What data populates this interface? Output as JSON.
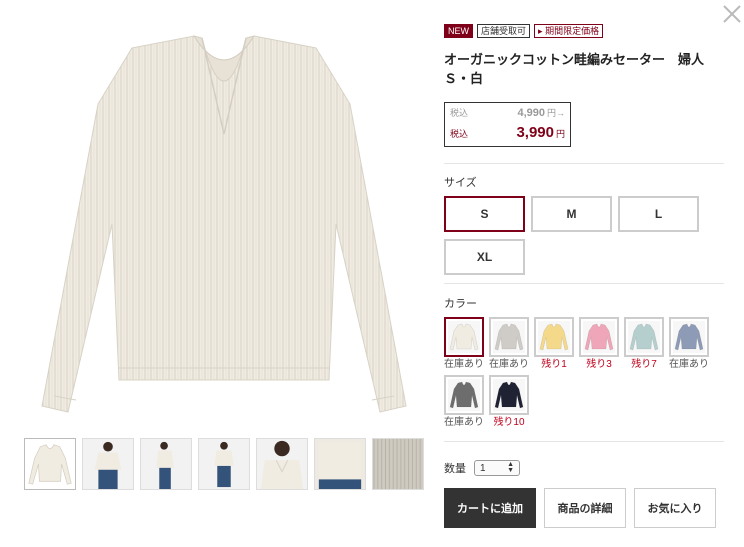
{
  "product": {
    "badges": {
      "new": "NEW",
      "store": "店舗受取可",
      "limited": "期間限定価格",
      "limited_marker": "▸"
    },
    "title_line1": "オーガニックコットン畦編みセーター　婦人",
    "title_line2": "Ｓ・白"
  },
  "price": {
    "original_tax_label": "税込",
    "original_amount": "4,990",
    "original_unit": "円→",
    "sale_tax_label": "税込",
    "sale_amount": "3,990",
    "sale_unit": "円"
  },
  "size": {
    "label": "サイズ",
    "options": [
      "S",
      "M",
      "L",
      "XL"
    ],
    "selected": "S"
  },
  "color": {
    "label": "カラー",
    "options": [
      {
        "hex": "#f1ece2",
        "stock": "在庫あり",
        "low": false,
        "selected": true
      },
      {
        "hex": "#cfcbc6",
        "stock": "在庫あり",
        "low": false,
        "selected": false
      },
      {
        "hex": "#f4d98a",
        "stock": "残り1",
        "low": true,
        "selected": false
      },
      {
        "hex": "#eea6b8",
        "stock": "残り3",
        "low": true,
        "selected": false
      },
      {
        "hex": "#b5cfcf",
        "stock": "残り7",
        "low": true,
        "selected": false
      },
      {
        "hex": "#8e9bb6",
        "stock": "在庫あり",
        "low": false,
        "selected": false
      },
      {
        "hex": "#6d6d6d",
        "stock": "在庫あり",
        "low": false,
        "selected": false
      },
      {
        "hex": "#1f2233",
        "stock": "残り10",
        "low": true,
        "selected": false
      }
    ]
  },
  "quantity": {
    "label": "数量",
    "value": "1"
  },
  "buttons": {
    "cart": "カートに追加",
    "detail": "商品の詳細",
    "favorite": "お気に入り"
  },
  "colors": {
    "accent": "#7f0019",
    "dark": "#333333",
    "sweater": "#f1ece2"
  },
  "thumbnails": [
    "sweater-flat",
    "model-front-jeans",
    "model-side",
    "model-front-full",
    "model-closeup",
    "model-detail",
    "knit-texture"
  ]
}
